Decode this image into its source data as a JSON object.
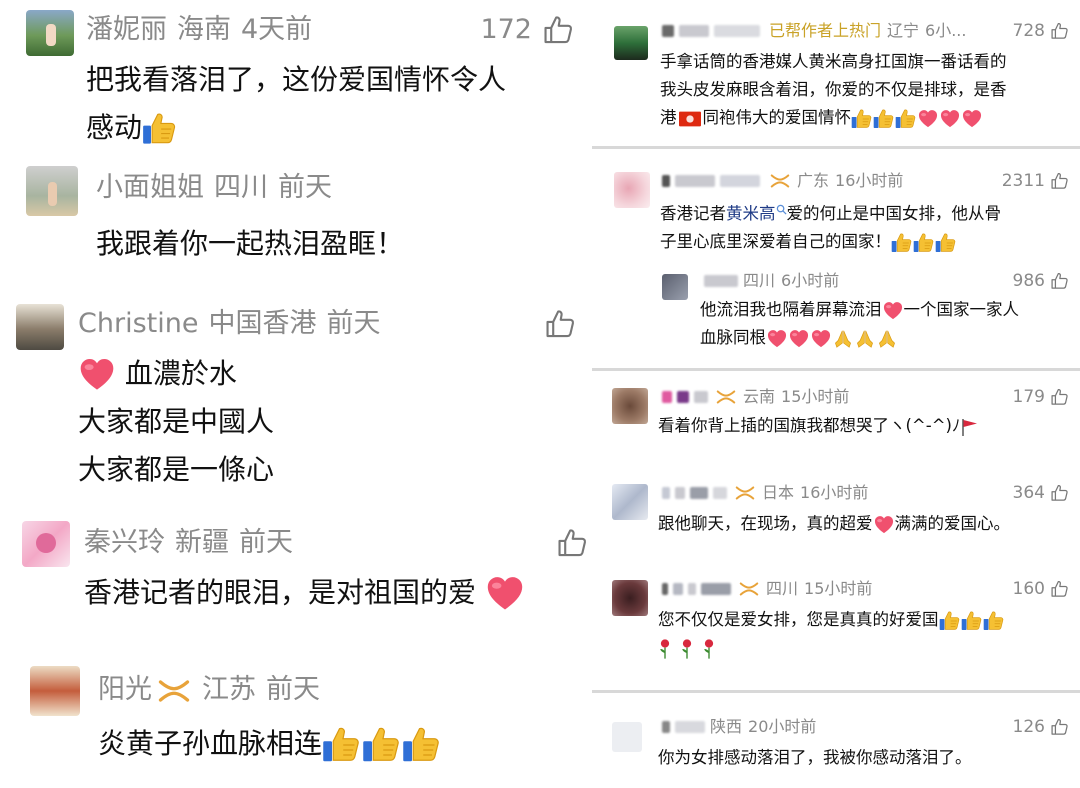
{
  "left": {
    "comments": [
      {
        "name": "潘妮丽",
        "region": "海南",
        "time": "4天前",
        "likes": "172",
        "lines": [
          "把我看落泪了，这份爱国情怀令人",
          "感动"
        ]
      },
      {
        "name": "小面姐姐",
        "region": "四川",
        "time": "前天",
        "likes": "",
        "lines": [
          "我跟着你一起热泪盈眶！"
        ]
      },
      {
        "name": "Christine",
        "region": "中国香港",
        "time": "前天",
        "likes": "",
        "lines": [
          "血濃於水",
          "大家都是中國人",
          "大家都是一條心"
        ]
      },
      {
        "name": "秦兴玲",
        "region": "新疆",
        "time": "前天",
        "likes": "",
        "lines": [
          "香港记者的眼泪，是对祖国的爱"
        ]
      },
      {
        "name": "阳光",
        "region": "江苏",
        "time": "前天",
        "likes": "",
        "lines": [
          "炎黄子孙血脉相连"
        ]
      }
    ]
  },
  "right": {
    "comments": [
      {
        "badge": "已帮作者上热门",
        "region": "辽宁",
        "time": "6小...",
        "likes": "728",
        "lines": [
          "手拿话筒的香港媒人黄米高身扛国旗一番话看的",
          "我头皮发麻眼含着泪，你爱的不仅是排球，是香",
          "同袍伟大的爱国情怀"
        ],
        "line3_prefix": "港"
      },
      {
        "region": "广东",
        "time": "16小时前",
        "likes": "2311",
        "line1_prefix": "香港记者",
        "line1_keyword": "黄米高",
        "line1_suffix": "爱的何止是中国女排，他从骨",
        "line2": "子里心底里深爱着自己的国家！"
      },
      {
        "region": "四川",
        "time": "6小时前",
        "likes": "986",
        "line1": "他流泪我也隔着屏幕流泪",
        "line1_suffix": "一个国家一家人",
        "line2": "血脉同根"
      },
      {
        "region": "云南",
        "time": "15小时前",
        "likes": "179",
        "line1": "看着你背上插的国旗我都想哭了ヽ(^-^)ﾉ"
      },
      {
        "region": "日本",
        "time": "16小时前",
        "likes": "364",
        "line1_prefix": "跟他聊天，在现场，真的超爱",
        "line1_suffix": "满满的爱国心。"
      },
      {
        "region": "四川",
        "time": "15小时前",
        "likes": "160",
        "line1": "您不仅仅是爱女排，您是真真的好爱国"
      },
      {
        "region": "陕西",
        "time": "20小时前",
        "likes": "126",
        "line1": "你为女排感动落泪了，我被你感动落泪了。"
      }
    ]
  }
}
